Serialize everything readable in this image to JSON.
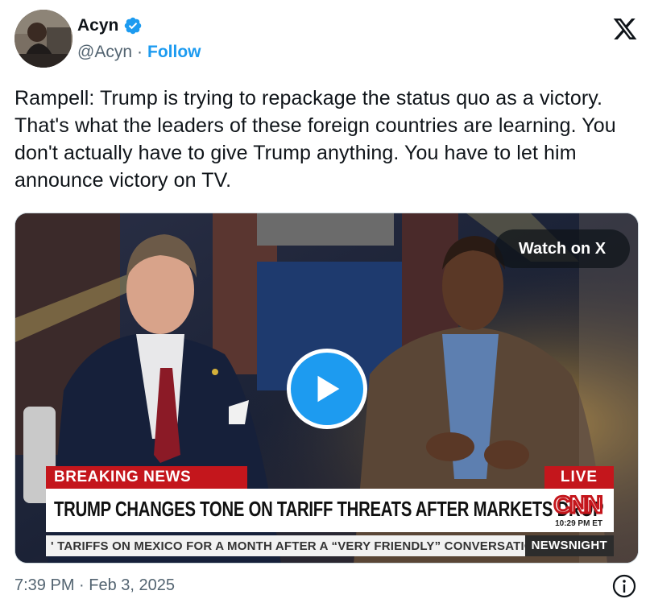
{
  "author": {
    "display_name": "Acyn",
    "handle": "@Acyn",
    "separator": "·",
    "follow_label": "Follow",
    "verified_color": "#1d9bf0"
  },
  "tweet": {
    "text": "Rampell: Trump is trying to repackage the status quo as a victory. That's what the leaders of these foreign countries are learning. You don't actually have to give Trump anything. You have to let him announce victory on TV.",
    "timestamp": "7:39 PM · Feb 3, 2025"
  },
  "video": {
    "watch_label": "Watch on X",
    "breaking_label": "BREAKING NEWS",
    "live_label": "LIVE",
    "headline": "TRUMP CHANGES TONE ON TARIFF THREATS AFTER MARKETS DROP",
    "network_logo": "CNN",
    "broadcast_time": "10:29 PM ET",
    "ticker": "' TARIFFS ON MEXICO FOR A MONTH AFTER A “VERY FRIENDLY” CONVERSATION WITH",
    "ticker_tag": "NEWSNIGHT"
  },
  "icons": {
    "platform": "x-logo-icon",
    "verified": "verified-badge-icon",
    "play": "play-icon",
    "info": "info-icon"
  },
  "colors": {
    "accent": "#1d9bf0",
    "cnn_red": "#c4161c",
    "text": "#0f1419",
    "muted": "#536471"
  }
}
